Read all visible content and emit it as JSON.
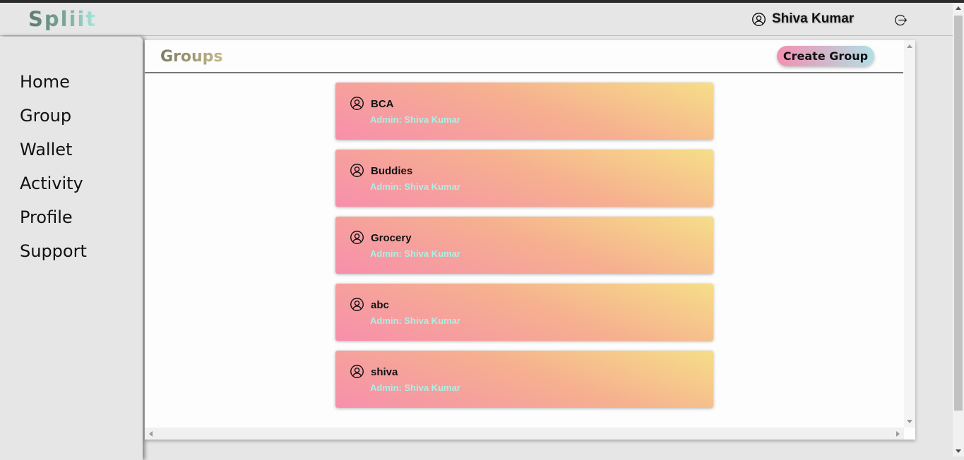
{
  "app": {
    "logo": "Spliit"
  },
  "header": {
    "user_name": "Shiva Kumar",
    "user_icon": "user-circle-icon",
    "logout_icon": "logout-icon"
  },
  "sidebar": {
    "items": [
      {
        "label": "Home"
      },
      {
        "label": "Group"
      },
      {
        "label": "Wallet"
      },
      {
        "label": "Activity"
      },
      {
        "label": "Profile"
      },
      {
        "label": "Support"
      }
    ]
  },
  "main": {
    "title": "Groups",
    "create_button": "Create Group",
    "groups": [
      {
        "name": "BCA",
        "admin": "Admin: Shiva Kumar",
        "icon": "user-circle-icon"
      },
      {
        "name": "Buddies",
        "admin": "Admin: Shiva Kumar",
        "icon": "user-circle-icon"
      },
      {
        "name": "Grocery",
        "admin": "Admin: Shiva Kumar",
        "icon": "user-circle-icon"
      },
      {
        "name": "abc",
        "admin": "Admin: Shiva Kumar",
        "icon": "user-circle-icon"
      },
      {
        "name": "shiva",
        "admin": "Admin: Shiva Kumar",
        "icon": "user-circle-icon"
      }
    ]
  },
  "colors": {
    "card_gradient_start": "#f78fac",
    "card_gradient_end": "#f6de88",
    "admin_text": "#aaf0e6",
    "button_gradient_start": "#f48fb1",
    "button_gradient_end": "#b0e0e6"
  }
}
